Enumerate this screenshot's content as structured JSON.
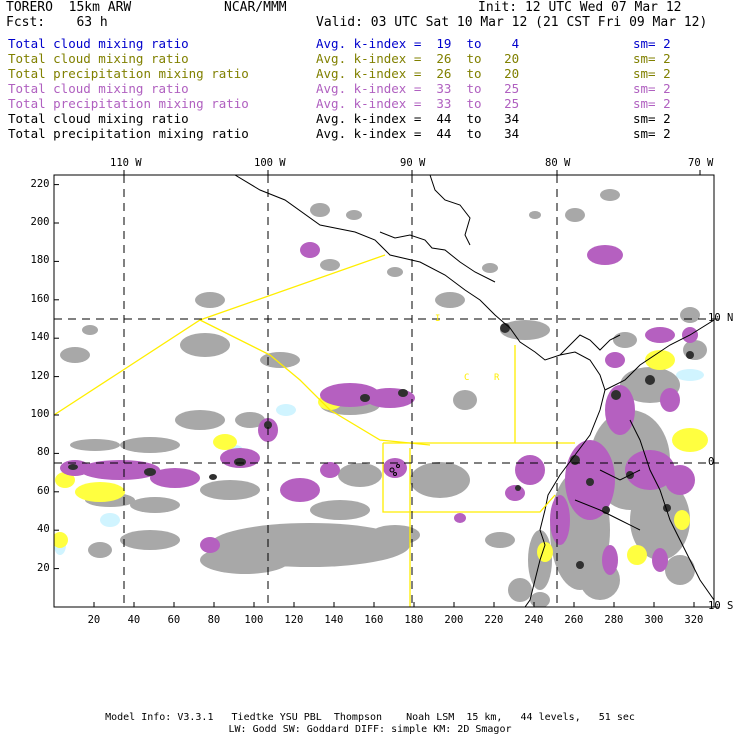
{
  "header": {
    "model": "TORERO  15km ARW",
    "org": "NCAR/MMM",
    "init": "Init: 12 UTC Wed 07 Mar 12",
    "fcst": "Fcst:    63 h",
    "valid": "Valid: 03 UTC Sat 10 Mar 12 (21 CST Fri 09 Mar 12)"
  },
  "legend": [
    {
      "field": "Total cloud mixing ratio",
      "kindex": "Avg. k-index =  19  to    4",
      "sm": "sm= 2",
      "color": "#0000cc"
    },
    {
      "field": "Total cloud mixing ratio",
      "kindex": "Avg. k-index =  26  to   20",
      "sm": "sm= 2",
      "color": "#808000"
    },
    {
      "field": "Total precipitation mixing ratio",
      "kindex": "Avg. k-index =  26  to   20",
      "sm": "sm= 2",
      "color": "#808000"
    },
    {
      "field": "Total cloud mixing ratio",
      "kindex": "Avg. k-index =  33  to   25",
      "sm": "sm= 2",
      "color": "#b060c0"
    },
    {
      "field": "Total precipitation mixing ratio",
      "kindex": "Avg. k-index =  33  to   25",
      "sm": "sm= 2",
      "color": "#b060c0"
    },
    {
      "field": "Total cloud mixing ratio",
      "kindex": "Avg. k-index =  44  to   34",
      "sm": "sm= 2",
      "color": "#000000"
    },
    {
      "field": "Total precipitation mixing ratio",
      "kindex": "Avg. k-index =  44  to   34",
      "sm": "sm= 2",
      "color": "#000000"
    }
  ],
  "map": {
    "top_lon_labels": [
      "110 W",
      "100 W",
      "90 W",
      "80 W",
      "70 W"
    ],
    "right_lat_labels": [
      "10 N",
      "0",
      "10 S"
    ],
    "x_ticks": [
      "20",
      "40",
      "60",
      "80",
      "100",
      "120",
      "140",
      "160",
      "180",
      "200",
      "220",
      "240",
      "260",
      "280",
      "300",
      "320"
    ],
    "y_ticks": [
      "220",
      "200",
      "180",
      "160",
      "140",
      "120",
      "100",
      "80",
      "60",
      "40",
      "20"
    ],
    "annotations": [
      "C",
      "R",
      "I"
    ],
    "colors": {
      "grey_cloud": "#a8a8a8",
      "dark_cloud": "#303030",
      "purple": "#b560c0",
      "yellow": "#ffff40",
      "light_blue": "#d0f4ff",
      "boundary_yellow": "#ffee00"
    }
  },
  "footer": {
    "line1": "Model Info: V3.3.1   Tiedtke YSU PBL  Thompson    Noah LSM  15 km,   44 levels,   51 sec",
    "line2": "LW: Godd SW: Goddard DIFF: simple KM: 2D Smagor"
  }
}
